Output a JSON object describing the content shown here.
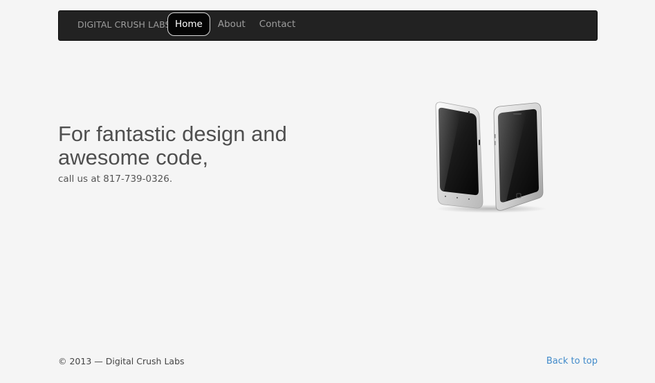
{
  "navbar": {
    "brand": "DIGITAL CRUSH LABS",
    "items": [
      {
        "label": "Home",
        "active": true
      },
      {
        "label": "About",
        "active": false
      },
      {
        "label": "Contact",
        "active": false
      }
    ]
  },
  "hero": {
    "title": "For fantastic design and awesome code,",
    "subtitle": "call us at 817-739-0326.",
    "image": "two-smartphones-illustration"
  },
  "footer": {
    "copyright": "© 2013 — Digital Crush Labs",
    "back_to_top": "Back to top"
  },
  "colors": {
    "background": "#f5f5f5",
    "navbar": "#222222",
    "link": "#428bca",
    "heading": "#4f4f4f"
  }
}
